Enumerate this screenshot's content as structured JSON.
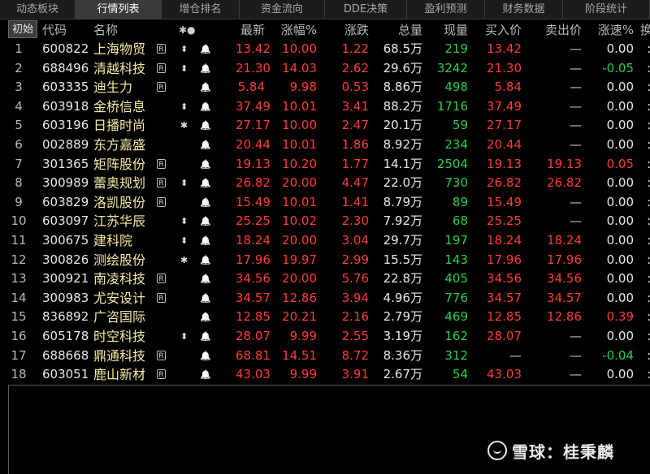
{
  "tabs": [
    "动态板块",
    "行情列表",
    "增仓排名",
    "资金流向",
    "DDE决策",
    "盈利预测",
    "财务数据",
    "阶段统计"
  ],
  "active_tab_index": 1,
  "header": {
    "init_button": "初始",
    "code": "代码",
    "name": "名称",
    "marker": "✱●",
    "latest": "最新",
    "change_pct": "涨幅%",
    "change": "涨跌",
    "volume": "总量",
    "current_vol": "现量",
    "bid": "买入价",
    "ask": "卖出价",
    "speed": "涨速%",
    "more": "换"
  },
  "rows": [
    {
      "idx": "1",
      "code": "600822",
      "name": "上海物贸",
      "r": true,
      "arrow": "updown",
      "latest": "13.42",
      "pct": "10.00",
      "chg": "1.22",
      "vol": "68.5万",
      "cur": "219",
      "bid": "13.42",
      "ask": "—",
      "speed": "0.00",
      "speed_color": "white"
    },
    {
      "idx": "2",
      "code": "688496",
      "name": "清越科技",
      "r": true,
      "arrow": "updown",
      "latest": "21.30",
      "pct": "14.03",
      "chg": "2.62",
      "vol": "29.6万",
      "cur": "3242",
      "bid": "21.30",
      "ask": "—",
      "speed": "-0.05",
      "speed_color": "green"
    },
    {
      "idx": "3",
      "code": "603335",
      "name": "迪生力",
      "r": true,
      "arrow": "",
      "latest": "5.84",
      "pct": "9.98",
      "chg": "0.53",
      "vol": "8.86万",
      "cur": "498",
      "bid": "5.84",
      "ask": "—",
      "speed": "0.00",
      "speed_color": "white"
    },
    {
      "idx": "4",
      "code": "603918",
      "name": "金桥信息",
      "r": false,
      "arrow": "updown",
      "latest": "37.49",
      "pct": "10.01",
      "chg": "3.41",
      "vol": "88.2万",
      "cur": "1716",
      "bid": "37.49",
      "ask": "—",
      "speed": "0.00",
      "speed_color": "white"
    },
    {
      "idx": "5",
      "code": "603196",
      "name": "日播时尚",
      "r": false,
      "arrow": "star",
      "latest": "27.17",
      "pct": "10.00",
      "chg": "2.47",
      "vol": "20.1万",
      "cur": "59",
      "bid": "27.17",
      "ask": "—",
      "speed": "0.00",
      "speed_color": "white"
    },
    {
      "idx": "6",
      "code": "002889",
      "name": "东方嘉盛",
      "r": false,
      "arrow": "",
      "latest": "20.44",
      "pct": "10.01",
      "chg": "1.86",
      "vol": "8.92万",
      "cur": "234",
      "bid": "20.44",
      "ask": "—",
      "speed": "0.00",
      "speed_color": "white"
    },
    {
      "idx": "7",
      "code": "301365",
      "name": "矩阵股份",
      "r": true,
      "arrow": "",
      "latest": "19.13",
      "pct": "10.20",
      "chg": "1.77",
      "vol": "14.1万",
      "cur": "2504",
      "bid": "19.13",
      "ask": "19.13",
      "speed": "0.05",
      "speed_color": "red"
    },
    {
      "idx": "8",
      "code": "300989",
      "name": "蕾奥规划",
      "r": true,
      "arrow": "updown",
      "latest": "26.82",
      "pct": "20.00",
      "chg": "4.47",
      "vol": "22.0万",
      "cur": "730",
      "bid": "26.82",
      "ask": "26.82",
      "speed": "0.00",
      "speed_color": "white"
    },
    {
      "idx": "9",
      "code": "603829",
      "name": "洛凯股份",
      "r": true,
      "arrow": "",
      "latest": "15.49",
      "pct": "10.01",
      "chg": "1.41",
      "vol": "8.79万",
      "cur": "89",
      "bid": "15.49",
      "ask": "—",
      "speed": "0.00",
      "speed_color": "white"
    },
    {
      "idx": "10",
      "code": "603097",
      "name": "江苏华辰",
      "r": false,
      "arrow": "updown",
      "latest": "25.25",
      "pct": "10.02",
      "chg": "2.30",
      "vol": "7.92万",
      "cur": "68",
      "bid": "25.25",
      "ask": "—",
      "speed": "0.00",
      "speed_color": "white"
    },
    {
      "idx": "11",
      "code": "300675",
      "name": "建科院",
      "r": false,
      "arrow": "updown",
      "latest": "18.24",
      "pct": "20.00",
      "chg": "3.04",
      "vol": "29.7万",
      "cur": "197",
      "bid": "18.24",
      "ask": "18.24",
      "speed": "0.00",
      "speed_color": "white"
    },
    {
      "idx": "12",
      "code": "300826",
      "name": "测绘股份",
      "r": false,
      "arrow": "star",
      "latest": "17.96",
      "pct": "19.97",
      "chg": "2.99",
      "vol": "15.5万",
      "cur": "143",
      "bid": "17.96",
      "ask": "17.96",
      "speed": "0.00",
      "speed_color": "white"
    },
    {
      "idx": "13",
      "code": "300921",
      "name": "南凌科技",
      "r": true,
      "arrow": "",
      "latest": "34.56",
      "pct": "20.00",
      "chg": "5.76",
      "vol": "22.8万",
      "cur": "405",
      "bid": "34.56",
      "ask": "34.56",
      "speed": "0.00",
      "speed_color": "white"
    },
    {
      "idx": "14",
      "code": "300983",
      "name": "尤安设计",
      "r": true,
      "arrow": "",
      "latest": "34.57",
      "pct": "12.86",
      "chg": "3.94",
      "vol": "4.96万",
      "cur": "776",
      "bid": "34.57",
      "ask": "34.57",
      "speed": "0.00",
      "speed_color": "white"
    },
    {
      "idx": "15",
      "code": "836892",
      "name": "广咨国际",
      "r": false,
      "arrow": "",
      "latest": "12.85",
      "pct": "20.21",
      "chg": "2.16",
      "vol": "2.79万",
      "cur": "469",
      "bid": "12.85",
      "ask": "12.86",
      "speed": "0.39",
      "speed_color": "red"
    },
    {
      "idx": "16",
      "code": "605178",
      "name": "时空科技",
      "r": false,
      "arrow": "updown",
      "latest": "28.07",
      "pct": "9.99",
      "chg": "2.55",
      "vol": "3.19万",
      "cur": "162",
      "bid": "28.07",
      "ask": "—",
      "speed": "0.00",
      "speed_color": "white"
    },
    {
      "idx": "17",
      "code": "688668",
      "name": "鼎通科技",
      "r": true,
      "arrow": "",
      "latest": "68.81",
      "pct": "14.51",
      "chg": "8.72",
      "vol": "8.36万",
      "cur": "312",
      "bid": "—",
      "ask": "—",
      "speed": "-0.04",
      "speed_color": "green"
    },
    {
      "idx": "18",
      "code": "603051",
      "name": "鹿山新材",
      "r": true,
      "arrow": "",
      "latest": "43.03",
      "pct": "9.99",
      "chg": "3.91",
      "vol": "2.67万",
      "cur": "54",
      "bid": "43.03",
      "ask": "—",
      "speed": "0.00",
      "speed_color": "white"
    }
  ],
  "watermark": {
    "text": "雪球：桂秉麟"
  },
  "colors": {
    "up": "#ff3b3b",
    "down": "#25d04a",
    "name": "#f4e9a0"
  }
}
